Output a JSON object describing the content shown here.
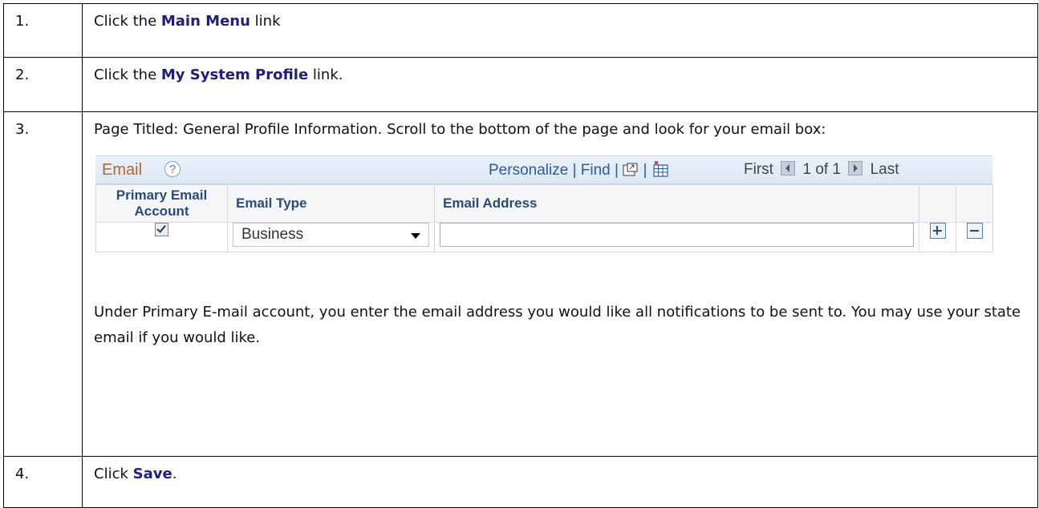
{
  "steps": [
    {
      "num": "1.",
      "pre": "Click the ",
      "bold": "Main Menu",
      "post": " link"
    },
    {
      "num": "2.",
      "pre": "Click the ",
      "bold": "My System Profile",
      "post": " link."
    },
    {
      "num": "3.",
      "text": "Page Titled: General Profile Information. Scroll to the bottom of the page and look for your email box:",
      "after": "Under Primary E-mail account, you enter the email address you would like all notifications to be sent to. You may use your state email if you would like."
    },
    {
      "num": "4.",
      "pre": "Click ",
      "bold": "Save",
      "post": "."
    }
  ],
  "email_grid": {
    "title": "Email",
    "help_glyph": "?",
    "personalize": "Personalize",
    "find": "Find",
    "sep": "|",
    "first": "First",
    "count": "1 of 1",
    "last": "Last",
    "columns": [
      "Primary Email Account",
      "Email Type",
      "Email Address"
    ],
    "row": {
      "primary_checked": true,
      "email_type": "Business",
      "email_address": ""
    }
  },
  "colors": {
    "keyword": "#1f1f7a",
    "grid_link": "#2e5a9a",
    "grid_title": "#b0663a"
  }
}
